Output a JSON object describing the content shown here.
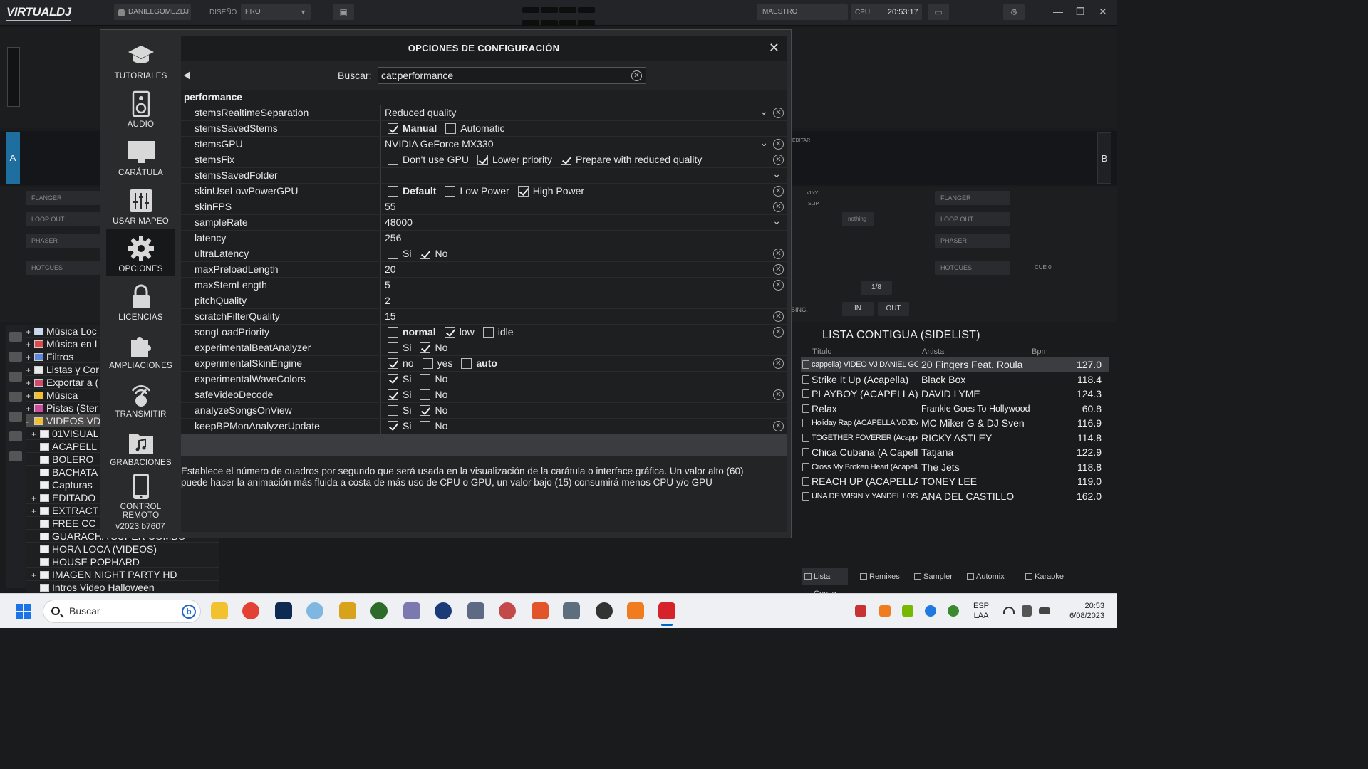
{
  "app": {
    "logo": "VIRTUALDJ",
    "user": "DANIELGOMEZDJ",
    "design_label": "DISEÑO",
    "design_value": "PRO",
    "master_label": "MAESTRO",
    "cpu_label": "CPU",
    "time": "20:53:17"
  },
  "decks": {
    "deck_a": "A",
    "deck_b": "B",
    "fx_left": [
      "FLANGER",
      "LOOP OUT",
      "PHASER"
    ],
    "fx_right": [
      "FLANGER",
      "LOOP OUT",
      "PHASER"
    ],
    "hotcues": "HOTCUES",
    "hotcues_right": "HOTCUES",
    "nothing": "nothing",
    "loop_size": "1/8",
    "in": "IN",
    "out": "OUT",
    "cue": "CUE 0",
    "vinyl": "VINYL",
    "slip": "SLIP",
    "sync": "SINC.",
    "editar": "EDITAR"
  },
  "tree": [
    {
      "label": "Música Loc",
      "plus": "+",
      "sel": false
    },
    {
      "label": "Música en L",
      "plus": "+",
      "sel": false
    },
    {
      "label": "Filtros",
      "plus": "+",
      "sel": false
    },
    {
      "label": "Listas y Cor",
      "plus": "+",
      "sel": false
    },
    {
      "label": "Exportar a (",
      "plus": "+",
      "sel": false
    },
    {
      "label": "Música",
      "plus": "+",
      "sel": false
    },
    {
      "label": "Pistas (Ster",
      "plus": "+",
      "sel": false
    },
    {
      "label": "VIDEOS VDJ",
      "plus": "-",
      "sel": true
    },
    {
      "label": "01VISUAL",
      "plus": "+",
      "sel": false
    },
    {
      "label": "ACAPELL",
      "plus": "",
      "sel": false
    },
    {
      "label": "BOLERO",
      "plus": "",
      "sel": false
    },
    {
      "label": "BACHATA",
      "plus": "",
      "sel": false
    },
    {
      "label": "Capturas",
      "plus": "",
      "sel": false
    },
    {
      "label": "EDITADO",
      "plus": "+",
      "sel": false
    },
    {
      "label": "EXTRACT",
      "plus": "+",
      "sel": false
    },
    {
      "label": "FREE CC",
      "plus": "",
      "sel": false
    },
    {
      "label": "GUARACHA SUPER COMBO",
      "plus": "",
      "sel": false
    },
    {
      "label": "HORA LOCA (VIDEOS)",
      "plus": "",
      "sel": false
    },
    {
      "label": "HOUSE POPHARD",
      "plus": "",
      "sel": false
    },
    {
      "label": "IMAGEN NIGHT PARTY HD",
      "plus": "+",
      "sel": false
    },
    {
      "label": "Intros Video Halloween",
      "plus": "",
      "sel": false
    }
  ],
  "sidelist": {
    "title": "LISTA CONTIGUA (SIDELIST)",
    "col_title": "Título",
    "col_artist": "Artista",
    "col_bpm": "Bpm",
    "sideview": "sideview",
    "rows": [
      {
        "title": "cappella) VIDEO VJ DANIEL GOME",
        "artist": "20 Fingers Feat. Roula",
        "bpm": "127.0",
        "hl": true,
        "small": true
      },
      {
        "title": "Strike It Up (Acapella)",
        "artist": "Black Box",
        "bpm": "118.4",
        "hl": false,
        "small": false
      },
      {
        "title": "PLAYBOY (ACAPELLA)",
        "artist": "DAVID LYME",
        "bpm": "124.3",
        "hl": false,
        "small": false
      },
      {
        "title": "Relax",
        "artist": "Frankie Goes To Hollywood",
        "bpm": "60.8",
        "hl": false,
        "small": false
      },
      {
        "title": "Holiday Rap (ACAPELLA VDJDA...",
        "artist": "MC Miker G & DJ Sven",
        "bpm": "116.9",
        "hl": false,
        "small": true
      },
      {
        "title": "TOGETHER FOVERER (Acappe...",
        "artist": "RICKY ASTLEY",
        "bpm": "114.8",
        "hl": false,
        "small": true
      },
      {
        "title": "Chica Cubana (A Capella)",
        "artist": "Tatjana",
        "bpm": "122.9",
        "hl": false,
        "small": false
      },
      {
        "title": "Cross My Broken Heart (Acapella...",
        "artist": "The Jets",
        "bpm": "118.8",
        "hl": false,
        "small": true
      },
      {
        "title": "REACH UP (ACAPELLA)",
        "artist": "TONEY LEE",
        "bpm": "119.0",
        "hl": false,
        "small": false
      },
      {
        "title": "UNA DE WISIN Y YANDEL LOS...",
        "artist": "ANA DEL CASTILLO",
        "bpm": "162.0",
        "hl": false,
        "small": true
      }
    ],
    "tabs": [
      "Lista Contig",
      "Remixes",
      "Sampler",
      "Automix",
      "Karaoke"
    ]
  },
  "dialog": {
    "title": "OPCIONES DE CONFIGURACIÓN",
    "close": "✕",
    "search_label": "Buscar:",
    "search_value": "cat:performance",
    "category": "performance",
    "version": "v2023 b7607",
    "nav": [
      {
        "label": "TUTORIALES",
        "icon": "graduation-cap-icon",
        "active": false
      },
      {
        "label": "AUDIO",
        "icon": "speaker-icon",
        "active": false
      },
      {
        "label": "CARÁTULA",
        "icon": "monitor-icon",
        "active": false
      },
      {
        "label": "USAR MAPEO",
        "icon": "sliders-icon",
        "active": false
      },
      {
        "label": "OPCIONES",
        "icon": "gear-icon",
        "active": true
      },
      {
        "label": "LICENCIAS",
        "icon": "lock-icon",
        "active": false
      },
      {
        "label": "AMPLIACIONES",
        "icon": "puzzle-icon",
        "active": false
      },
      {
        "label": "TRANSMITIR",
        "icon": "broadcast-icon",
        "active": false
      },
      {
        "label": "GRABACIONES",
        "icon": "music-folder-icon",
        "active": false
      },
      {
        "label": "CONTROL REMOTO",
        "icon": "tablet-icon",
        "active": false
      }
    ],
    "options": [
      {
        "name": "stemsRealtimeSeparation",
        "type": "select",
        "value": "Reduced quality",
        "reset": true
      },
      {
        "name": "stemsSavedStems",
        "type": "checks",
        "items": [
          {
            "label": "Manual",
            "on": true,
            "bold": true
          },
          {
            "label": "Automatic",
            "on": false,
            "bold": false
          }
        ],
        "reset": false
      },
      {
        "name": "stemsGPU",
        "type": "select",
        "value": "NVIDIA GeForce MX330",
        "reset": true
      },
      {
        "name": "stemsFix",
        "type": "checks",
        "items": [
          {
            "label": "Don't use GPU",
            "on": false,
            "bold": false
          },
          {
            "label": "Lower priority",
            "on": true,
            "bold": false
          },
          {
            "label": "Prepare with reduced quality",
            "on": true,
            "bold": false
          }
        ],
        "reset": true
      },
      {
        "name": "stemsSavedFolder",
        "type": "select2",
        "value": "",
        "reset": false
      },
      {
        "name": "skinUseLowPowerGPU",
        "type": "checks",
        "items": [
          {
            "label": "Default",
            "on": false,
            "bold": true
          },
          {
            "label": "Low Power",
            "on": false,
            "bold": false
          },
          {
            "label": "High Power",
            "on": true,
            "bold": false
          }
        ],
        "reset": true
      },
      {
        "name": "skinFPS",
        "type": "text",
        "value": "55",
        "reset": true
      },
      {
        "name": "sampleRate",
        "type": "select2",
        "value": "48000",
        "reset": false
      },
      {
        "name": "latency",
        "type": "text",
        "value": "256",
        "reset": false
      },
      {
        "name": "ultraLatency",
        "type": "checks",
        "items": [
          {
            "label": "Si",
            "on": false,
            "bold": false
          },
          {
            "label": "No",
            "on": true,
            "bold": false
          }
        ],
        "reset": true
      },
      {
        "name": "maxPreloadLength",
        "type": "text",
        "value": "20",
        "reset": true
      },
      {
        "name": "maxStemLength",
        "type": "text",
        "value": "5",
        "reset": true
      },
      {
        "name": "pitchQuality",
        "type": "text",
        "value": "2",
        "reset": false
      },
      {
        "name": "scratchFilterQuality",
        "type": "text",
        "value": "15",
        "reset": true
      },
      {
        "name": "songLoadPriority",
        "type": "checks",
        "items": [
          {
            "label": "normal",
            "on": false,
            "bold": true
          },
          {
            "label": "low",
            "on": true,
            "bold": false
          },
          {
            "label": "idle",
            "on": false,
            "bold": false
          }
        ],
        "reset": true
      },
      {
        "name": "experimentalBeatAnalyzer",
        "type": "checks",
        "items": [
          {
            "label": "Si",
            "on": false,
            "bold": false
          },
          {
            "label": "No",
            "on": true,
            "bold": false
          }
        ],
        "reset": false
      },
      {
        "name": "experimentalSkinEngine",
        "type": "checks",
        "items": [
          {
            "label": "no",
            "on": true,
            "bold": false
          },
          {
            "label": "yes",
            "on": false,
            "bold": false
          },
          {
            "label": "auto",
            "on": false,
            "bold": true
          }
        ],
        "reset": true
      },
      {
        "name": "experimentalWaveColors",
        "type": "checks",
        "items": [
          {
            "label": "Si",
            "on": true,
            "bold": false
          },
          {
            "label": "No",
            "on": false,
            "bold": false
          }
        ],
        "reset": false
      },
      {
        "name": "safeVideoDecode",
        "type": "checks",
        "items": [
          {
            "label": "Si",
            "on": true,
            "bold": false
          },
          {
            "label": "No",
            "on": false,
            "bold": false
          }
        ],
        "reset": true
      },
      {
        "name": "analyzeSongsOnView",
        "type": "checks",
        "items": [
          {
            "label": "Si",
            "on": false,
            "bold": false
          },
          {
            "label": "No",
            "on": true,
            "bold": false
          }
        ],
        "reset": false
      },
      {
        "name": "keepBPMonAnalyzerUpdate",
        "type": "checks",
        "items": [
          {
            "label": "Si",
            "on": true,
            "bold": false
          },
          {
            "label": "No",
            "on": false,
            "bold": false
          }
        ],
        "reset": true
      }
    ],
    "description": "Establece el número de cuadros por segundo que será usada en la visualización de la carátula o interface gráfica. Un valor alto (60) puede hacer la animación más fluida a costa de más uso de CPU o GPU, un valor bajo (15) consumirá menos CPU y/o GPU"
  },
  "taskbar": {
    "search_placeholder": "Buscar",
    "lang_1": "ESP",
    "lang_2": "LAA",
    "time": "20:53",
    "date": "6/08/2023"
  }
}
